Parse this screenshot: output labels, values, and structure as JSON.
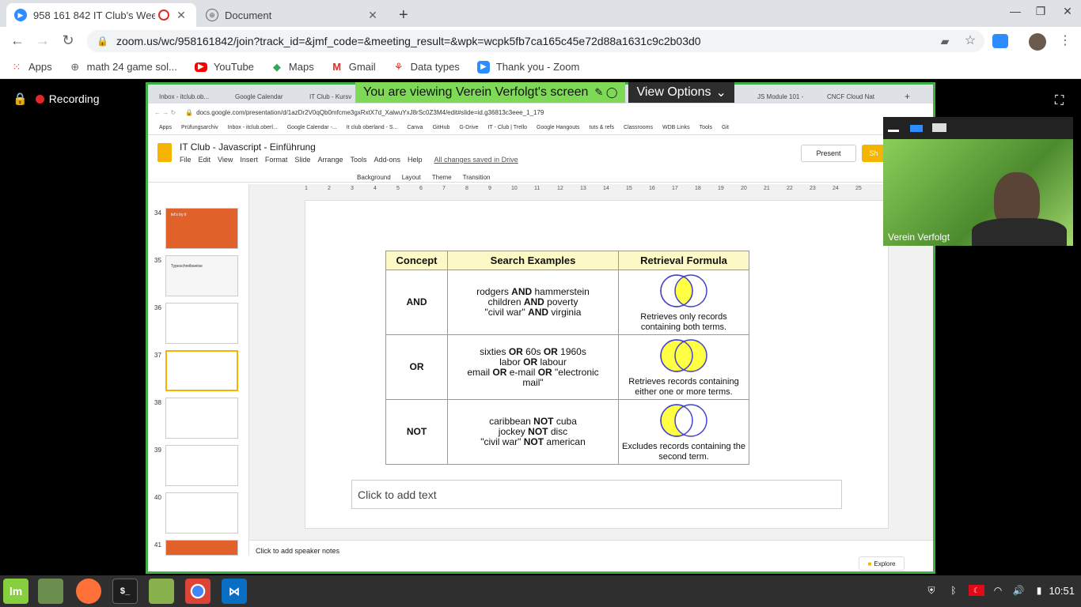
{
  "browser": {
    "tabs": [
      {
        "title": "958 161 842 IT Club's Weel",
        "icon": "zoom-icon",
        "active": true
      },
      {
        "title": "Document",
        "icon": "globe-icon",
        "active": false
      }
    ],
    "new_tab": "+",
    "url": "zoom.us/wc/958161842/join?track_id=&jmf_code=&meeting_result=&wpk=wcpk5fb7ca165c45e72d88a1631c9c2b03d0",
    "bookmarks": [
      "Apps",
      "math 24 game sol...",
      "YouTube",
      "Maps",
      "Gmail",
      "Data types",
      "Thank you - Zoom"
    ]
  },
  "zoom": {
    "recording_label": "Recording",
    "viewing_banner": "You are viewing Verein Verfolgt's screen",
    "view_options": "View Options",
    "participant_name": "Verein Verfolgt"
  },
  "shared": {
    "inner_tabs": [
      "Inbox - itclub.ob...",
      "Google Calendar",
      "IT Club - Kursv",
      "JS Module 101 -",
      "CNCF Cloud Nat"
    ],
    "inner_url": "docs.google.com/presentation/d/1azDr2V0qQb0mfcme3gxRxtX7d_XalwuYxJ8rSc0Z3M4/edit#slide=id.g36813c3eee_1_179",
    "inner_bookmarks": [
      "Apps",
      "Prüfungsarchiv",
      "Inbox - itclub.oberl...",
      "Google Calendar -...",
      "It club oberland - S...",
      "Canva",
      "GitHub",
      "G-Drive",
      "IT - Club | Trello",
      "Google Hangouts",
      "tuts & refs",
      "Classrooms",
      "WDB Links",
      "Tools",
      "Git"
    ],
    "doc_title": "IT Club - Javascript - Einführung",
    "menus": [
      "File",
      "Edit",
      "View",
      "Insert",
      "Format",
      "Slide",
      "Arrange",
      "Tools",
      "Add-ons",
      "Help"
    ],
    "saved": "All changes saved in Drive",
    "present": "Present",
    "share_fragment": "Sh",
    "toolbar_items": [
      "Background",
      "Layout",
      "Theme",
      "Transition"
    ],
    "slide_numbers": [
      "34",
      "35",
      "36",
      "37",
      "38",
      "39",
      "40",
      "41"
    ],
    "thumb_34_text": "let's try it",
    "thumb_35_text": "Typeschreibweise",
    "ruler": [
      "1",
      "2",
      "3",
      "4",
      "5",
      "6",
      "7",
      "8",
      "9",
      "10",
      "11",
      "12",
      "13",
      "14",
      "15",
      "16",
      "17",
      "18",
      "19",
      "20",
      "21",
      "22",
      "23",
      "24",
      "25"
    ],
    "table": {
      "headers": [
        "Concept",
        "Search Examples",
        "Retrieval Formula"
      ],
      "rows": [
        {
          "concept": "AND",
          "lines": [
            [
              "rodgers ",
              "AND",
              " hammerstein"
            ],
            [
              "children ",
              "AND",
              " poverty"
            ],
            [
              "\"civil war\" ",
              "AND",
              " virginia"
            ]
          ],
          "formula": "Retrieves only records containing both terms."
        },
        {
          "concept": "OR",
          "lines": [
            [
              "sixties ",
              "OR",
              " 60s ",
              "OR",
              " 1960s"
            ],
            [
              "labor ",
              "OR",
              " labour"
            ],
            [
              "email ",
              "OR",
              " e-mail ",
              "OR",
              " \"electronic"
            ],
            [
              "mail\""
            ]
          ],
          "formula": "Retrieves records containing either one or more terms."
        },
        {
          "concept": "NOT",
          "lines": [
            [
              "caribbean ",
              "NOT",
              " cuba"
            ],
            [
              "jockey ",
              "NOT",
              " disc"
            ],
            [
              "\"civil war\" ",
              "NOT",
              " american"
            ]
          ],
          "formula": "Excludes records containing the second term."
        }
      ]
    },
    "text_placeholder": "Click to add text",
    "notes_placeholder": "Click to add speaker notes",
    "explore": "Explore"
  },
  "taskbar": {
    "time": "10:51"
  },
  "colors": {
    "share_border": "#3cb043",
    "venn_fill": "#ffff44",
    "venn_stroke": "#4444cc",
    "slide_orange": "#e0622a",
    "header_yellow": "#fdf9c6"
  }
}
